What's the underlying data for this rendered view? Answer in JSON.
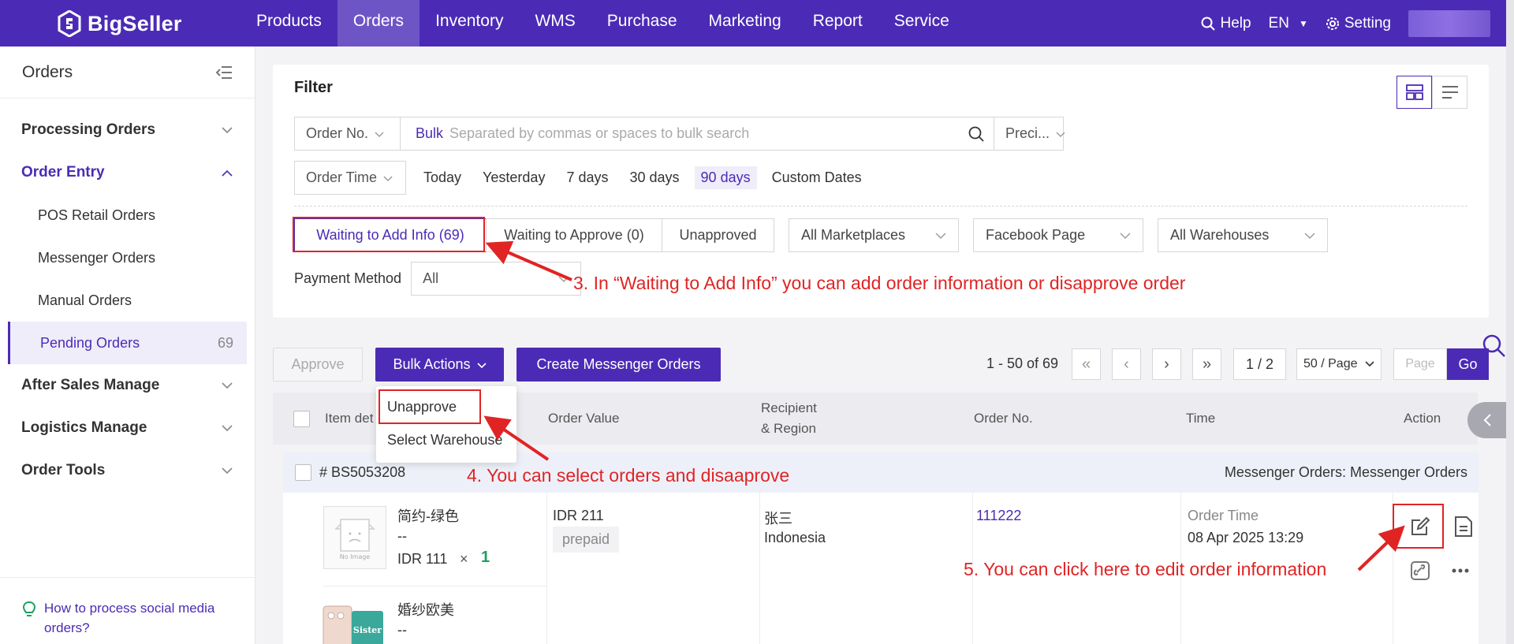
{
  "brand": "BigSeller",
  "nav": [
    "Products",
    "Orders",
    "Inventory",
    "WMS",
    "Purchase",
    "Marketing",
    "Report",
    "Service"
  ],
  "top_right": {
    "help": "Help",
    "lang": "EN",
    "setting": "Setting"
  },
  "sidebar": {
    "title": "Orders",
    "groups": {
      "processing": "Processing Orders",
      "order_entry": "Order Entry",
      "after_sales": "After Sales Manage",
      "logistics": "Logistics Manage",
      "order_tools": "Order Tools"
    },
    "sub": [
      "POS Retail Orders",
      "Messenger Orders",
      "Manual Orders",
      "Pending Orders"
    ],
    "pending_count": "69",
    "help_link": "How to process social media orders?"
  },
  "filter": {
    "title": "Filter",
    "order_no_select": "Order No.",
    "bulk_label": "Bulk",
    "search_placeholder": "Separated by commas or spaces to bulk search",
    "precision_select": "Preci...",
    "time_select": "Order Time",
    "time_options": [
      "Today",
      "Yesterday",
      "7 days",
      "30 days",
      "90 days",
      "Custom Dates"
    ],
    "tabs": [
      "Waiting to Add Info (69)",
      "Waiting to Approve (0)",
      "Unapproved"
    ],
    "dropdowns": [
      "All Marketplaces",
      "Facebook Page",
      "All Warehouses"
    ],
    "payment_label": "Payment Method",
    "payment_value": "All"
  },
  "annotations": {
    "a3": "3. In “Waiting to Add Info” you can add order information or disapprove order",
    "a4": "4. You can select orders and disaaprove",
    "a5": "5. You can click here to edit order information"
  },
  "toolbar": {
    "approve": "Approve",
    "bulk_actions": "Bulk Actions",
    "create": "Create Messenger Orders",
    "range": "1 - 50 of 69",
    "page": "1 / 2",
    "per_page": "50 / Page",
    "page_placeholder": "Page",
    "go": "Go"
  },
  "bulk_menu": [
    "Unapprove",
    "Select Warehouse"
  ],
  "table": {
    "headers": {
      "item": "Item det",
      "value": "Order Value",
      "recipient_1": "Recipient",
      "recipient_2": "& Region",
      "order_no": "Order No.",
      "time": "Time",
      "action": "Action"
    }
  },
  "order": {
    "id": "# BS5053208",
    "channel": "Messenger Orders: Messenger Orders",
    "item1_name": "简约-绿色",
    "item1_variant": "--",
    "item1_price": "IDR 111",
    "item1_times": "×",
    "item1_qty": "1",
    "item2_name": "婚纱欧美",
    "item2_variant": "--",
    "value": "IDR 211",
    "payment_tag": "prepaid",
    "recipient": "张三",
    "region": "Indonesia",
    "order_no": "111222",
    "time_label": "Order Time",
    "time_value": "08 Apr 2025 13:29",
    "no_image": "No Image",
    "sister": "Sister"
  },
  "colors": {
    "brand": "#4b2bb5",
    "annotation": "#e02424",
    "qty": "#1aa260"
  }
}
